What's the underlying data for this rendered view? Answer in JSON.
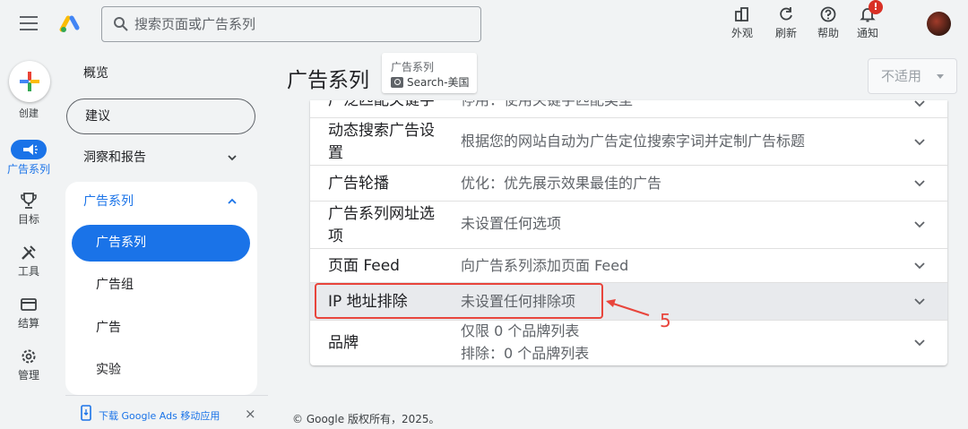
{
  "header": {
    "search_placeholder": "搜索页面或广告系列",
    "tools": [
      {
        "label": "外观",
        "icon": "appearance-icon"
      },
      {
        "label": "刷新",
        "icon": "refresh-icon"
      },
      {
        "label": "帮助",
        "icon": "help-icon"
      },
      {
        "label": "通知",
        "icon": "bell-icon",
        "badge": "!"
      }
    ]
  },
  "rail": {
    "create_label": "创建",
    "items": [
      {
        "label": "广告系列",
        "icon": "megaphone-icon",
        "active": true
      },
      {
        "label": "目标",
        "icon": "trophy-icon"
      },
      {
        "label": "工具",
        "icon": "tools-icon"
      },
      {
        "label": "结算",
        "icon": "card-icon"
      },
      {
        "label": "管理",
        "icon": "gear-icon"
      }
    ]
  },
  "nav": {
    "overview": "概览",
    "recommendations": "建议",
    "insights": "洞察和报告",
    "group_title": "广告系列",
    "sub_items": [
      "广告系列",
      "广告组",
      "广告",
      "实验"
    ],
    "download_text": "下载 Google Ads 移动应用",
    "close": "×"
  },
  "main": {
    "title": "广告系列",
    "crumb_label": "广告系列",
    "crumb_value": "Search-美国",
    "select_value": "不适用"
  },
  "settings": [
    {
      "label": "广泛匹配关键字",
      "value": "停用：使用关键字匹配类型"
    },
    {
      "label_lines": [
        "动态搜索广告设",
        "置"
      ],
      "value": "根据您的网站自动为广告定位搜索字词并定制广告标题"
    },
    {
      "label": "广告轮播",
      "value": "优化：优先展示效果最佳的广告"
    },
    {
      "label_lines": [
        "广告系列网址选",
        "项"
      ],
      "value": "未设置任何选项"
    },
    {
      "label": "页面 Feed",
      "value": "向广告系列添加页面 Feed"
    },
    {
      "label": "IP 地址排除",
      "value": "未设置任何排除项"
    },
    {
      "label": "品牌",
      "value_lines": [
        "仅限 0 个品牌列表",
        "排除：0 个品牌列表"
      ]
    }
  ],
  "annotation": {
    "number": "5",
    "color": "#e8453c"
  },
  "footer": "© Google 版权所有，2025。",
  "colors": {
    "accent": "#1a73e8",
    "background": "#f1f3f4",
    "highlight_row": "#e8eaed"
  }
}
